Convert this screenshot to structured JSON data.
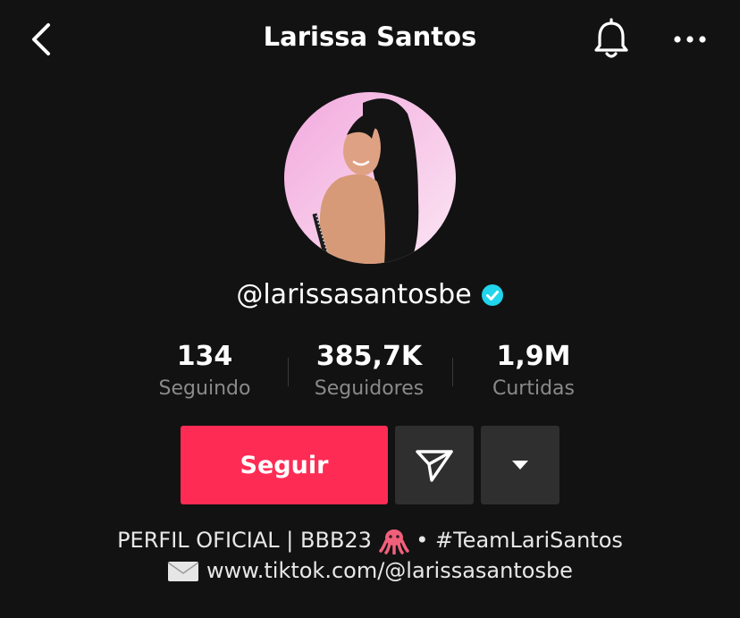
{
  "header": {
    "title": "Larissa Santos",
    "back_icon": "chevron-left-icon",
    "bell_icon": "bell-icon",
    "more_icon": "more-horizontal-icon"
  },
  "profile": {
    "handle": "@larissasantosbe",
    "verified": true,
    "verified_color": "#20d5ec"
  },
  "stats": [
    {
      "value": "134",
      "label": "Seguindo"
    },
    {
      "value": "385,7K",
      "label": "Seguidores"
    },
    {
      "value": "1,9M",
      "label": "Curtidas"
    }
  ],
  "actions": {
    "follow_label": "Seguir",
    "follow_color": "#fe2c55",
    "message_icon": "send-icon",
    "dropdown_icon": "caret-down-icon"
  },
  "bio": {
    "line1_part1": "PERFIL OFICIAL | BBB23 ",
    "line1_emoji": "octopus-emoji",
    "line1_part2": " • #TeamLariSantos",
    "line2_icon": "envelope-icon",
    "line2_text": "www.tiktok.com/@larissasantosbe"
  }
}
